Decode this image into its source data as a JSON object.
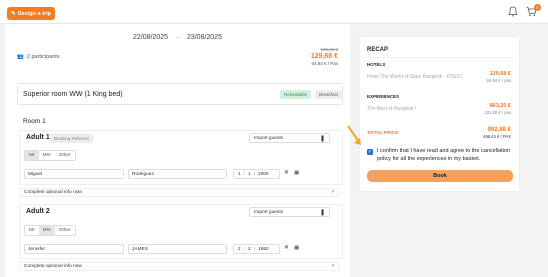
{
  "header": {
    "design_trip_label": "Design a trip",
    "bell_icon": "bell-icon",
    "cart_icon": "cart-icon",
    "cart_count": "0"
  },
  "trip": {
    "date_from": "22/08/2025",
    "date_to": "23/08/2025",
    "participants": "2 participants",
    "price_old": "135,50 €",
    "price_new": "129,68 €",
    "price_per_pax": "64,84 € / Pax"
  },
  "room": {
    "title": "Superior room WW (1 King bed)",
    "badge_refundable": "Refundable",
    "badge_breakfast": "Breakfast",
    "room_label": "Room 1"
  },
  "adults": [
    {
      "title": "Adult 1",
      "booking_ref": "Booking Referent",
      "import_label": "Import guests",
      "genders": [
        "Mr",
        "Mrs",
        "Other"
      ],
      "first_name": "Miguel",
      "last_name": "Rodriguez",
      "day": "1",
      "month": "1",
      "year": "2005",
      "optional_label": "Complete optional info now"
    },
    {
      "title": "Adult 2",
      "import_label": "Import guests",
      "genders": [
        "Mr",
        "Mrs",
        "Other"
      ],
      "first_name": "Jennifer",
      "last_name": "JAMES",
      "day": "2",
      "month": "2",
      "year": "1982",
      "optional_label": "Complete optional info now"
    }
  ],
  "recap": {
    "title": "RECAP",
    "hotels_label": "HOTELS",
    "hotel_name": "Hotel The World of Siam Bangkok - KTEST",
    "hotel_price": "129,68 €",
    "hotel_price_pax": "64,84 € / pax",
    "experiences_label": "EXPERIENCES",
    "experience_name": "The Best of Bangkok !",
    "experience_price": "863,20 €",
    "experience_price_pax": "431,60 € / pax",
    "total_label": "TOTAL PRICE",
    "total_price": "992,88 €",
    "total_price_pax": "496,44 € / PAX",
    "confirm_text": "I confirm that I have read and agree to the cancellation policy for all the experiences in my basket.",
    "book_label": "Book"
  },
  "colors": {
    "accent": "#f47b20",
    "checkbox": "#2b6fd6"
  }
}
